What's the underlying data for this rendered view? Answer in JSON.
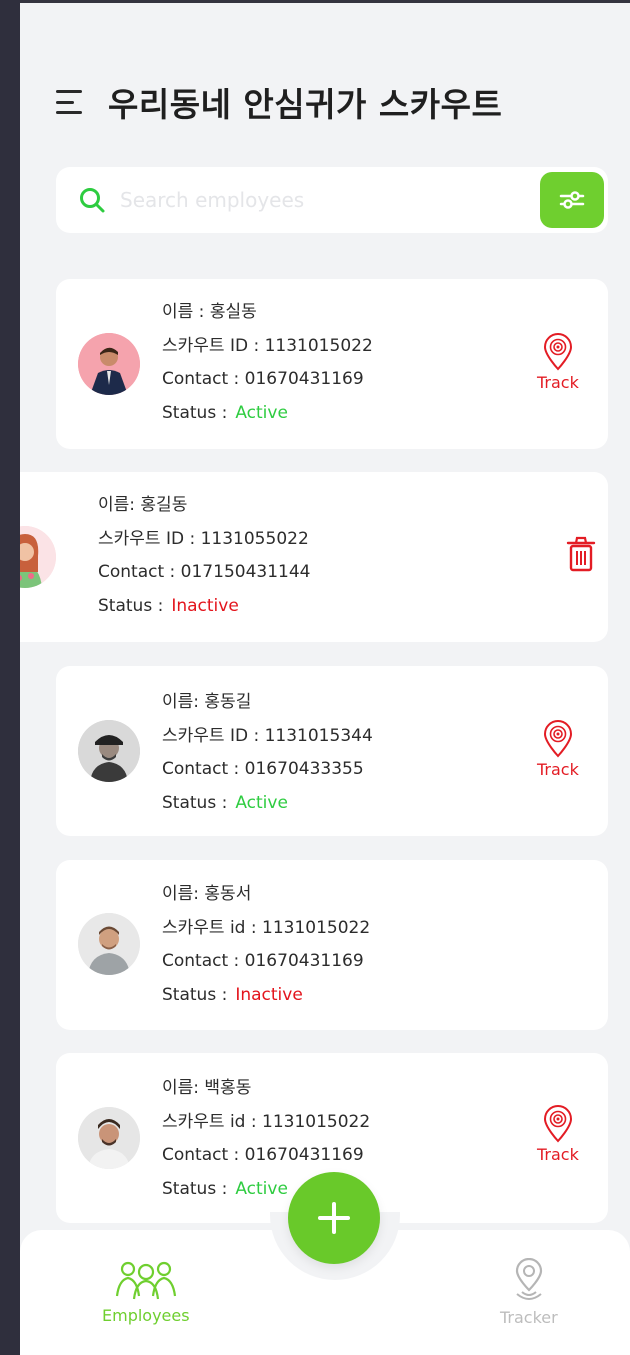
{
  "header": {
    "title": "우리동네 안심귀가 스카우트"
  },
  "search": {
    "placeholder": "Search employees"
  },
  "employees": [
    {
      "name_line": "이름 : 홍실동",
      "id_line": "스카우트 ID : 1131015022",
      "contact_line": "Contact : 01670431169",
      "status_label": "Status :",
      "status": "Active",
      "action": "Track"
    },
    {
      "name_line": "이름: 홍길동",
      "id_line": "스카우트 ID : 1131055022",
      "contact_line": "Contact : 017150431144",
      "status_label": "Status :",
      "status": "Inactive",
      "action": "delete"
    },
    {
      "name_line": "이름: 홍동길",
      "id_line": "스카우트 ID : 1131015344",
      "contact_line": "Contact : 01670433355",
      "status_label": "Status :",
      "status": "Active",
      "action": "Track"
    },
    {
      "name_line": "이름: 홍동서",
      "id_line": "스카우트 id : 1131015022",
      "contact_line": "Contact : 01670431169",
      "status_label": "Status :",
      "status": "Inactive",
      "action": "none"
    },
    {
      "name_line": "이름: 백홍동",
      "id_line": "스카우트 id : 1131015022",
      "contact_line": "Contact : 01670431169",
      "status_label": "Status :",
      "status": "Active",
      "action": "Track"
    }
  ],
  "track_label": "Track",
  "nav": {
    "employees": "Employees",
    "tracker": "Tracker"
  },
  "colors": {
    "accent": "#6fcf2f",
    "active": "#2ecc40",
    "inactive": "#e3141c",
    "track": "#e31c24",
    "nav_inactive": "#bdbdbd"
  },
  "icons": {
    "menu": "menu-icon",
    "search": "search-icon",
    "filter": "sliders-icon",
    "track": "location-target-icon",
    "delete": "trash-icon",
    "add": "plus-icon",
    "employees": "people-icon",
    "tracker": "map-pin-icon"
  }
}
